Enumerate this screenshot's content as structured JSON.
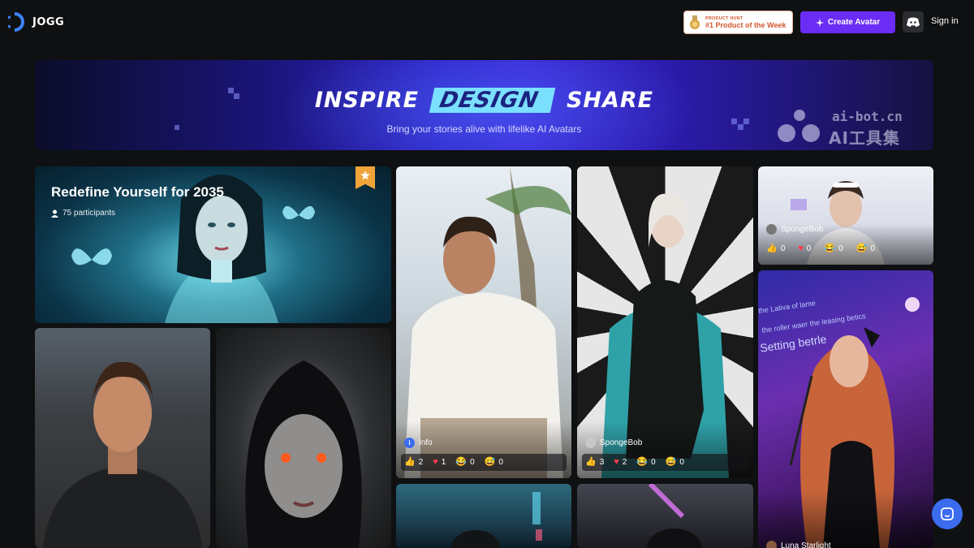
{
  "header": {
    "logo_text": "JOGG",
    "product_hunt": {
      "small": "PRODUCT HUNT",
      "big": "#1 Product of the Week"
    },
    "create_label": "Create Avatar",
    "signin_label": "Sign in"
  },
  "banner": {
    "word1": "INSPIRE",
    "word2": "DESIGN",
    "word3": "SHARE",
    "subtitle": "Bring your stories alive with lifelike AI Avatars",
    "watermark_top": "ai-bot.cn",
    "watermark_bottom": "AI工具集"
  },
  "feature": {
    "title": "Redefine Yourself for 2035",
    "participants": "75 participants"
  },
  "cards": {
    "man2": {
      "author": "Info",
      "reactions": {
        "like": "2",
        "heart": "1",
        "laugh": "0",
        "wow": "0"
      }
    },
    "blonde": {
      "author": "SpongeBob",
      "reactions": {
        "like": "3",
        "heart": "2",
        "laugh": "0",
        "wow": "0"
      }
    },
    "nurse": {
      "author": "SpongeBob",
      "reactions": {
        "like": "0",
        "heart": "0",
        "laugh": "0",
        "wow": "0"
      }
    },
    "singer": {
      "author": "Luna Starlight",
      "screen_lines": [
        "the Lativa of lame",
        "the roller waer the leasing betics",
        "Setting betrle"
      ]
    }
  },
  "colors": {
    "accent": "#6b2cf5",
    "chat": "#3b6cf0",
    "bookmark": "#f0a43a"
  }
}
